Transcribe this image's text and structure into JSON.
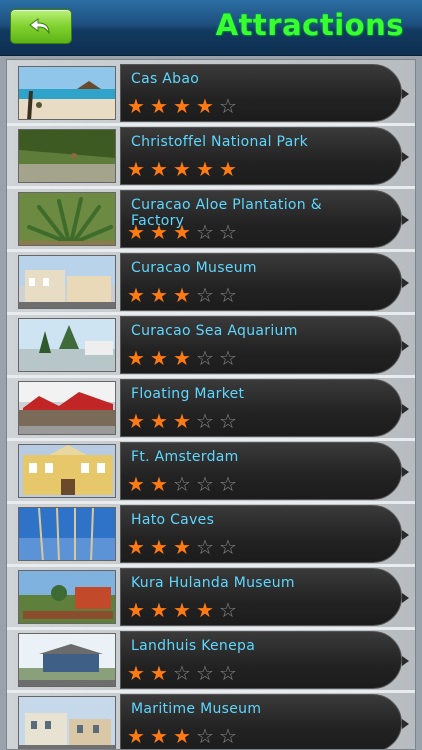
{
  "header": {
    "title": "Attractions",
    "back_icon": "back-arrow-icon"
  },
  "attractions": [
    {
      "name": "Cas Abao",
      "rating": 4
    },
    {
      "name": "Christoffel National Park",
      "rating": 5
    },
    {
      "name": "Curacao Aloe Plantation & Factory",
      "rating": 3
    },
    {
      "name": "Curacao Museum",
      "rating": 3
    },
    {
      "name": "Curacao Sea Aquarium",
      "rating": 3
    },
    {
      "name": "Floating Market",
      "rating": 3
    },
    {
      "name": "Ft. Amsterdam",
      "rating": 2
    },
    {
      "name": "Hato Caves",
      "rating": 3
    },
    {
      "name": "Kura Hulanda Museum",
      "rating": 4
    },
    {
      "name": "Landhuis Kenepa",
      "rating": 2
    },
    {
      "name": "Maritime Museum",
      "rating": 3
    }
  ],
  "rating_max": 5,
  "colors": {
    "star_filled": "#ff7a12",
    "star_empty": "#8a8a8a",
    "title": "#39ff2e",
    "name": "#5fd7ff"
  }
}
